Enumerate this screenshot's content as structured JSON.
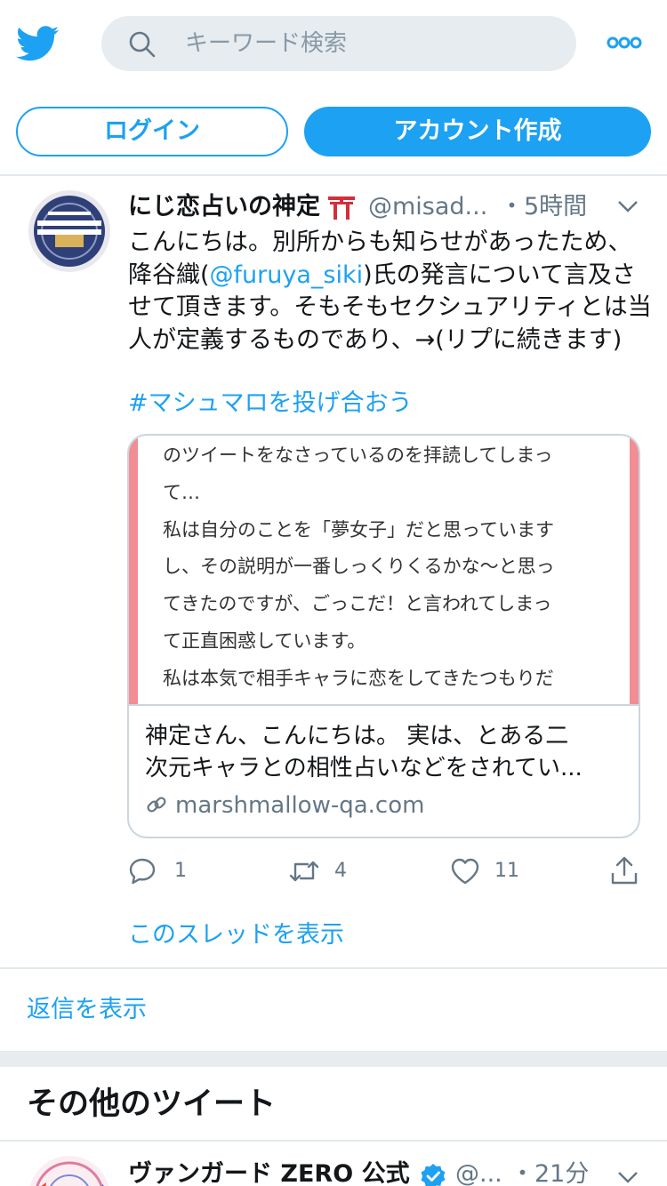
{
  "header": {
    "search_placeholder": "キーワード検索",
    "login_label": "ログイン",
    "signup_label": "アカウント作成"
  },
  "tweet": {
    "author_name": "にじ恋占いの神定",
    "author_emoji_icon": "torii-icon",
    "handle": "@misad...",
    "time": "・5時間",
    "text_before_mention": "こんにちは。別所からも知らせがあったため、降谷織(",
    "mention": "@furuya_siki",
    "text_after_mention": ")氏の発言について言及させて頂きます。そもそもセクシュアリティとは当人が定義するものであり、→(リプに続きます)",
    "hashtag": "#マシュマロを投げ合おう",
    "card": {
      "image_lines": [
        "のツイートをなさっているのを拝読してしまっ",
        "て…",
        "私は自分のことを「夢女子」だと思っています",
        "し、その説明が一番しっくりくるかな〜と思っ",
        "てきたのですが、ごっこだ！と言われてしまっ",
        "て正直困惑しています。",
        "私は本気で相手キャラに恋をしてきたつもりだ"
      ],
      "description_line1": "神定さん、こんにちは。 実は、とある二",
      "description_line2": "次元キャラとの相性占いなどをされてい...",
      "domain": "marshmallow-qa.com"
    },
    "reply_count": "1",
    "retweet_count": "4",
    "like_count": "11"
  },
  "thread_link": "このスレッドを表示",
  "replies_link": "返信を表示",
  "more_tweets_title": "その他のツイート",
  "tweet2": {
    "author_name": "ヴァンガード ZERO 公式",
    "handle": "@...",
    "time": "・21分"
  },
  "colors": {
    "accent": "#1da1f2",
    "card_border": "#f28d95",
    "text": "#14171a",
    "muted": "#657786"
  }
}
